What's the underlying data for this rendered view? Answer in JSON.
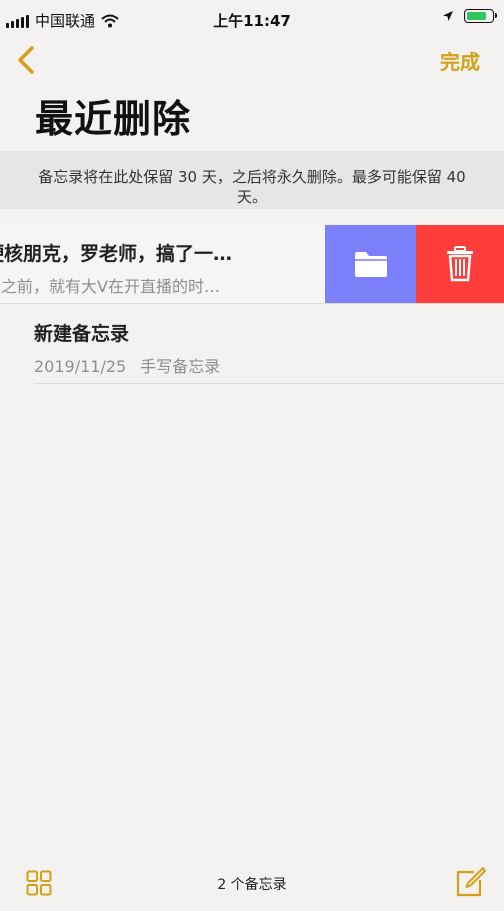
{
  "status_bar": {
    "carrier": "中国联通",
    "time": "上午11:47",
    "battery_level": 0.85,
    "icons": [
      "signal-icon",
      "wifi-icon",
      "location-icon",
      "battery-icon"
    ]
  },
  "nav": {
    "back_icon": "chevron-left-icon",
    "done_label": "完成",
    "title": "最近删除"
  },
  "banner": {
    "text": "备忘录将在此处保留 30 天，之后将永久删除。最多可能保留 40 天。"
  },
  "notes": [
    {
      "title": "硬核朋克，罗老师，搞了一…",
      "subtitle": "余之前，就有大V在开直播的时…",
      "swiped": true,
      "actions": [
        "folder-icon",
        "trash-icon"
      ]
    },
    {
      "title": "新建备忘录",
      "date": "2019/11/25",
      "subtitle": "手写备忘录"
    }
  ],
  "toolbar": {
    "grid_icon": "grid-icon",
    "count_label": "2 个备忘录",
    "compose_icon": "compose-icon"
  },
  "colors": {
    "accent": "#d4a017",
    "folder_action": "#7b7ff9",
    "delete_action": "#fc3d39",
    "battery": "#32c759"
  }
}
